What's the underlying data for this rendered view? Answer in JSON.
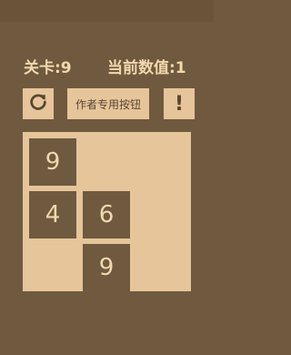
{
  "status": {
    "level_text": "关卡:9",
    "value_text": "当前数值:1"
  },
  "buttons": {
    "author_label": "作者专用按钮",
    "hint_label": "!"
  },
  "board": {
    "tiles": [
      "9",
      "4",
      "6",
      "9"
    ]
  },
  "colors": {
    "background": "#6f5a3f",
    "panel": "#e6c59a",
    "text_light": "#f3d7ad",
    "text_dark": "#5a4631"
  }
}
